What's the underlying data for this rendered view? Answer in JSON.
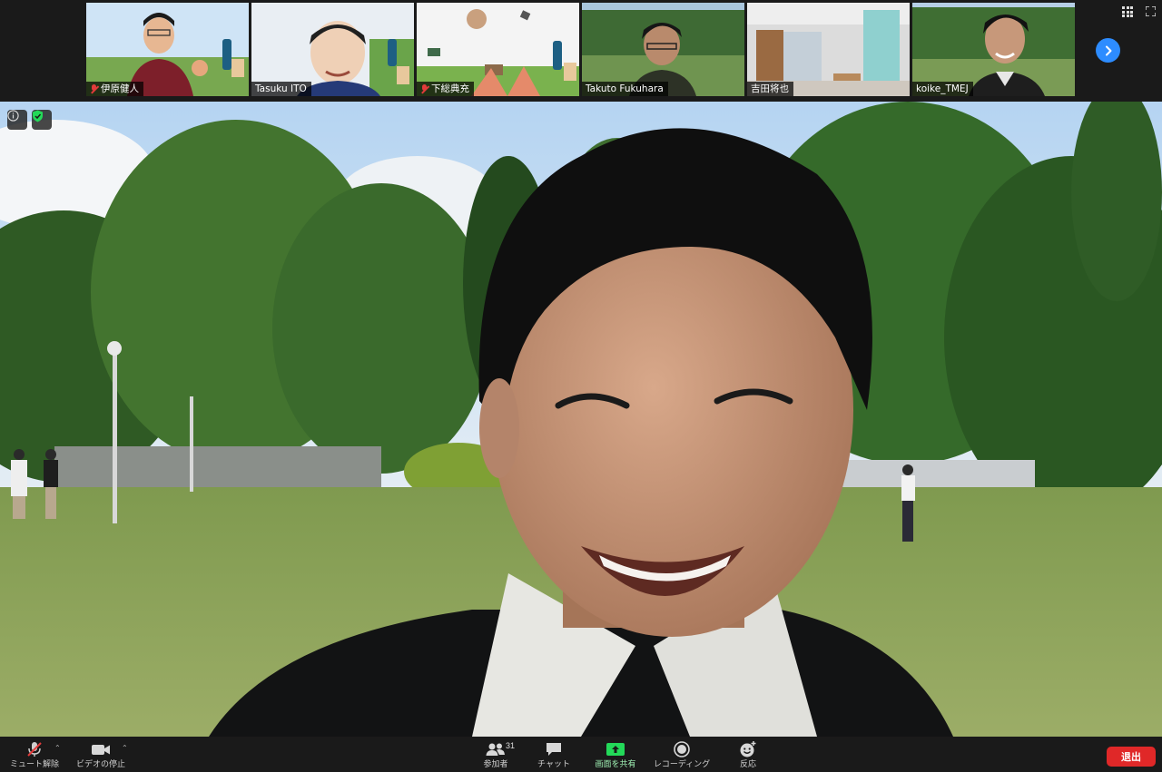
{
  "participants": [
    {
      "name": "伊原健人",
      "muted": true
    },
    {
      "name": "Tasuku ITO",
      "muted": false
    },
    {
      "name": "下総典充",
      "muted": true
    },
    {
      "name": "Takuto Fukuhara",
      "muted": false
    },
    {
      "name": "吉田将也",
      "muted": false
    },
    {
      "name": "koike_TMEJ",
      "muted": false,
      "active": true
    }
  ],
  "toolbar": {
    "mute_label": "ミュート解除",
    "video_label": "ビデオの停止",
    "participants_label": "参加者",
    "participants_count": "31",
    "chat_label": "チャット",
    "share_label": "画面を共有",
    "record_label": "レコーディング",
    "reactions_label": "反応",
    "leave_label": "退出"
  },
  "icons": {
    "mute": "mic-muted-icon",
    "video": "video-camera-icon",
    "participants": "people-icon",
    "chat": "chat-bubble-icon",
    "share": "share-screen-icon",
    "record": "record-icon",
    "reactions": "emoji-plus-icon",
    "next": "chevron-right-icon",
    "gallery": "gallery-grid-icon",
    "fullscreen": "fullscreen-icon",
    "info": "info-icon",
    "security": "shield-check-icon"
  },
  "colors": {
    "accent": "#2d8cff",
    "share_green": "#23d959",
    "leave_red": "#e02828",
    "active_speaker": "#d6e23a",
    "muted_red": "#e23b3b",
    "security_green": "#23d959"
  }
}
